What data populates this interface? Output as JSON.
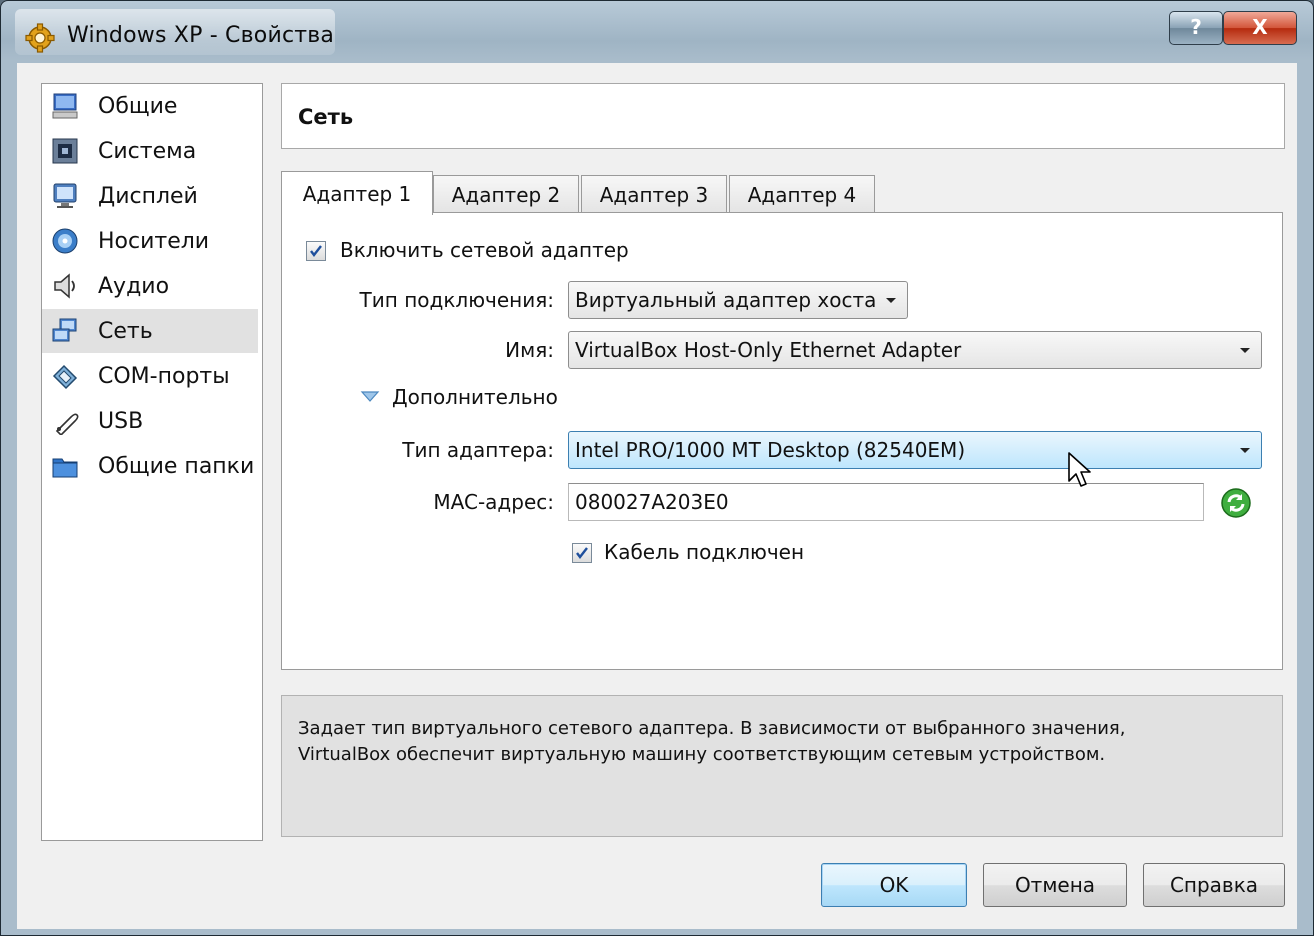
{
  "window": {
    "title": "Windows XP - Свойства",
    "help_label": "?",
    "close_label": "X"
  },
  "sidebar": {
    "items": [
      {
        "label": "Общие",
        "icon": "general-icon"
      },
      {
        "label": "Система",
        "icon": "system-icon"
      },
      {
        "label": "Дисплей",
        "icon": "display-icon"
      },
      {
        "label": "Носители",
        "icon": "storage-icon"
      },
      {
        "label": "Аудио",
        "icon": "audio-icon"
      },
      {
        "label": "Сеть",
        "icon": "network-icon",
        "selected": true
      },
      {
        "label": "COM-порты",
        "icon": "com-ports-icon"
      },
      {
        "label": "USB",
        "icon": "usb-icon"
      },
      {
        "label": "Общие папки",
        "icon": "shared-folders-icon"
      }
    ]
  },
  "header": {
    "title": "Сеть"
  },
  "tabs": [
    {
      "label": "Адаптер 1",
      "active": true
    },
    {
      "label": "Адаптер 2"
    },
    {
      "label": "Адаптер 3"
    },
    {
      "label": "Адаптер 4"
    }
  ],
  "adapter": {
    "enable_label": "Включить сетевой адаптер",
    "enable_checked": true,
    "attached_label": "Тип подключения:",
    "attached_value": "Виртуальный адаптер хоста",
    "name_label": "Имя:",
    "name_value": "VirtualBox Host-Only Ethernet Adapter",
    "advanced_label": "Дополнительно",
    "adapter_type_label": "Тип адаптера:",
    "adapter_type_value": "Intel PRO/1000 MT Desktop (82540EM)",
    "mac_label": "MAC-адрес:",
    "mac_value": "080027A203E0",
    "cable_label": "Кабель подключен",
    "cable_checked": true
  },
  "description": {
    "line1": "Задает тип виртуального сетевого адаптера. В зависимости от выбранного значения,",
    "line2": "VirtualBox обеспечит виртуальную машину соответствующим сетевым устройством."
  },
  "buttons": {
    "ok": "OK",
    "cancel": "Отмена",
    "help": "Справка"
  },
  "colors": {
    "accent": "#3c7fb1",
    "close_red": "#c4391c",
    "refresh_green": "#2e9e2e"
  }
}
